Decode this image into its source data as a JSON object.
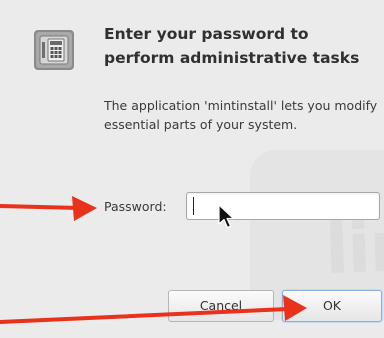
{
  "dialog": {
    "icon": "safe-lock-icon",
    "title": "Enter your password to perform administrative tasks",
    "message": "The application 'mintinstall' lets you modify essential parts of your system.",
    "watermark_text": "linux"
  },
  "password": {
    "label": "Password:",
    "value": "",
    "placeholder": ""
  },
  "buttons": {
    "cancel_label": "Cancel",
    "ok_label": "OK"
  },
  "annotations": {
    "arrow_color": "#e8321c"
  }
}
